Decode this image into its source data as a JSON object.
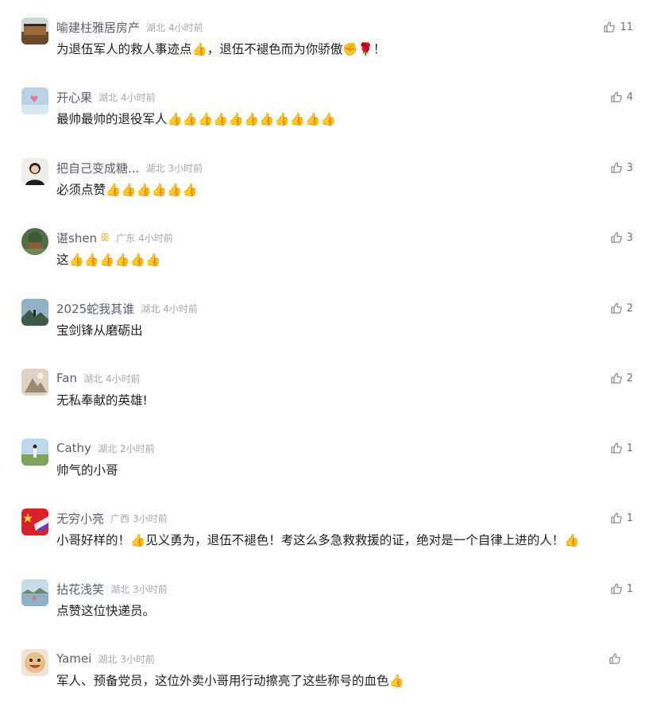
{
  "colors": {
    "name": "#5a5f6b",
    "meta": "#a6a8ae",
    "text": "#1f1f1f",
    "like_icon": "#8a8d94"
  },
  "comments": [
    {
      "name": "喻建柱雅居房产",
      "region": "湖北",
      "time": "4小时前",
      "text": "为退伍军人的救人事迹点👍，退伍不褪色而为你骄傲✊🌹！",
      "likes": "11",
      "avatar_icon": "building-avatar"
    },
    {
      "name": "开心果",
      "region": "湖北",
      "time": "4小时前",
      "text": "最帅最帅的退役军人👍👍👍👍👍👍👍👍👍👍👍",
      "likes": "4",
      "avatar_icon": "sky-heart-avatar"
    },
    {
      "name": "把自己变成糖...",
      "region": "湖北",
      "time": "3小时前",
      "text": "必须点赞👍👍👍👍👍👍",
      "likes": "3",
      "avatar_icon": "portrait-avatar"
    },
    {
      "name": "谌shen",
      "badge_icon": "ribbon-badge-icon",
      "region": "广东",
      "time": "4小时前",
      "text": "这👍👍👍👍👍👍",
      "likes": "3",
      "avatar_icon": "tree-avatar"
    },
    {
      "name": "2025蛇我其谁",
      "region": "湖北",
      "time": "4小时前",
      "text": "宝剑锋从磨砺出",
      "likes": "2",
      "avatar_icon": "landscape-avatar"
    },
    {
      "name": "Fan",
      "region": "湖北",
      "time": "4小时前",
      "text": "无私奉献的英雄!",
      "likes": "2",
      "avatar_icon": "photo-avatar"
    },
    {
      "name": "Cathy",
      "region": "湖北",
      "time": "2小时前",
      "text": "帅气的小哥",
      "likes": "1",
      "avatar_icon": "field-avatar"
    },
    {
      "name": "无穷小亮",
      "region": "广西",
      "time": "3小时前",
      "text": "小哥好样的！👍见义勇为，退伍不褪色！考这么多急救救援的证，绝对是一个自律上进的人！👍",
      "likes": "1",
      "avatar_icon": "flag-avatar"
    },
    {
      "name": "拈花浅笑",
      "region": "湖北",
      "time": "3小时前",
      "text": "点赞这位快递员。",
      "likes": "1",
      "avatar_icon": "lake-avatar"
    },
    {
      "name": "Yamei",
      "region": "湖北",
      "time": "3小时前",
      "text": "军人、预备党员，这位外卖小哥用行动擦亮了这些称号的血色👍",
      "likes": "",
      "avatar_icon": "smiley-avatar"
    }
  ]
}
